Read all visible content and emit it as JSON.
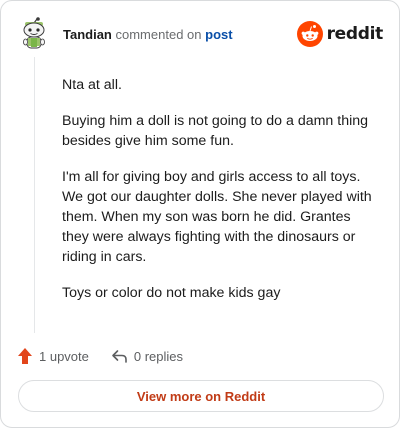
{
  "header": {
    "author": "Tandian",
    "commented_text": "commented on",
    "post_link": "post",
    "logo_text": "reddit"
  },
  "comment": {
    "paragraphs": [
      "Nta at all.",
      "Buying him a doll is not going to do a damn thing besides give him some fun.",
      "I'm all for giving boy and girls access to all toys. We got our daughter dolls. She never played with them. When my son was born he did. Grantes they were always fighting with the dinosaurs or riding in cars.",
      "Toys or color do not make kids gay"
    ]
  },
  "actions": {
    "upvotes": "1 upvote",
    "replies": "0 replies"
  },
  "footer": {
    "view_more": "View more on Reddit"
  },
  "colors": {
    "brand": "#ff4500",
    "upvote": "#e2451b",
    "link": "#0a4fa8",
    "view_more": "#c13b16"
  },
  "icons": {
    "avatar": "snoo-avatar-icon",
    "logo": "reddit-logo-icon",
    "upvote": "upvote-arrow-icon",
    "reply": "reply-arrow-icon"
  }
}
